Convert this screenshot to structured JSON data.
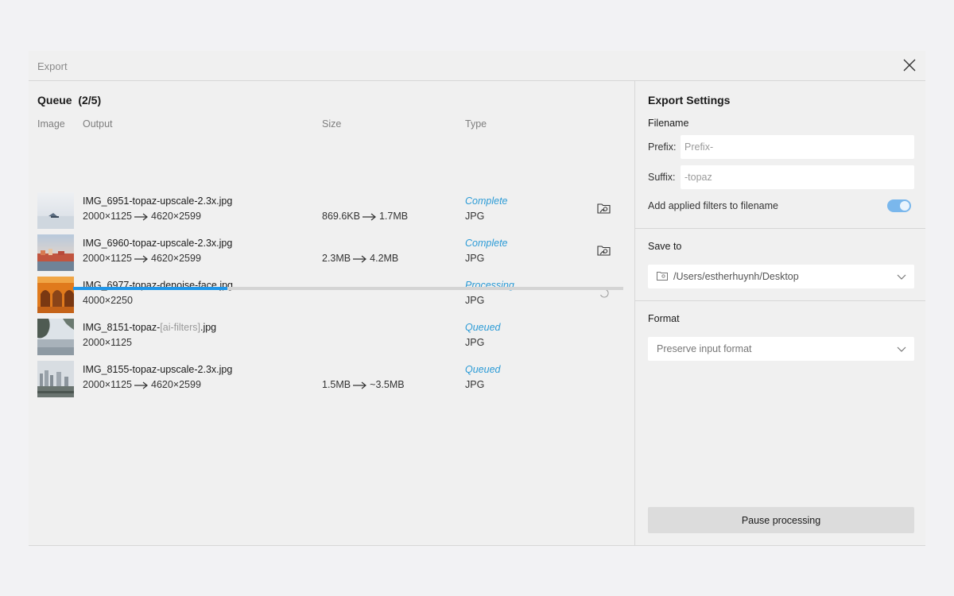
{
  "window": {
    "title": "Export"
  },
  "queue": {
    "title": "Queue  (2/5)",
    "columns": {
      "image": "Image",
      "output": "Output",
      "size": "Size",
      "type": "Type"
    },
    "rows": [
      {
        "name": "IMG_6951-topaz-upscale-2.3x.jpg",
        "dim_from": "2000×1125",
        "dim_to": "4620×2599",
        "size_from": "869.6KB",
        "size_to": "1.7MB",
        "status": "Complete",
        "type": "JPG"
      },
      {
        "name": "IMG_6960-topaz-upscale-2.3x.jpg",
        "dim_from": "2000×1125",
        "dim_to": "4620×2599",
        "size_from": "2.3MB",
        "size_to": "4.2MB",
        "status": "Complete",
        "type": "JPG"
      },
      {
        "name": "IMG_6977-topaz-denoise-face.jpg",
        "dim_from": "4000×2250",
        "status": "Processing...",
        "type": "JPG",
        "progress": 0.28
      },
      {
        "name_prefix": "IMG_8151-topaz-",
        "name_muted": "[ai-filters]",
        "name_suffix": ".jpg",
        "dim_from": "2000×1125",
        "status": "Queued",
        "type": "JPG"
      },
      {
        "name": "IMG_8155-topaz-upscale-2.3x.jpg",
        "dim_from": "2000×1125",
        "dim_to": "4620×2599",
        "size_from": "1.5MB",
        "size_to": "~3.5MB",
        "status": "Queued",
        "type": "JPG"
      }
    ]
  },
  "settings": {
    "title": "Export Settings",
    "filename": {
      "label": "Filename",
      "prefix_label": "Prefix:",
      "prefix_placeholder": "Prefix-",
      "suffix_label": "Suffix:",
      "suffix_placeholder": "-topaz",
      "filters_label": "Add applied filters to filename",
      "filters_enabled": true
    },
    "save_to": {
      "label": "Save to",
      "path": "/Users/estherhuynh/Desktop"
    },
    "format": {
      "label": "Format",
      "value": "Preserve input format"
    },
    "pause_label": "Pause processing"
  },
  "colors": {
    "accent": "#2196e8",
    "status_blue": "#2c9bd6",
    "toggle_on": "#7ab7ec"
  }
}
